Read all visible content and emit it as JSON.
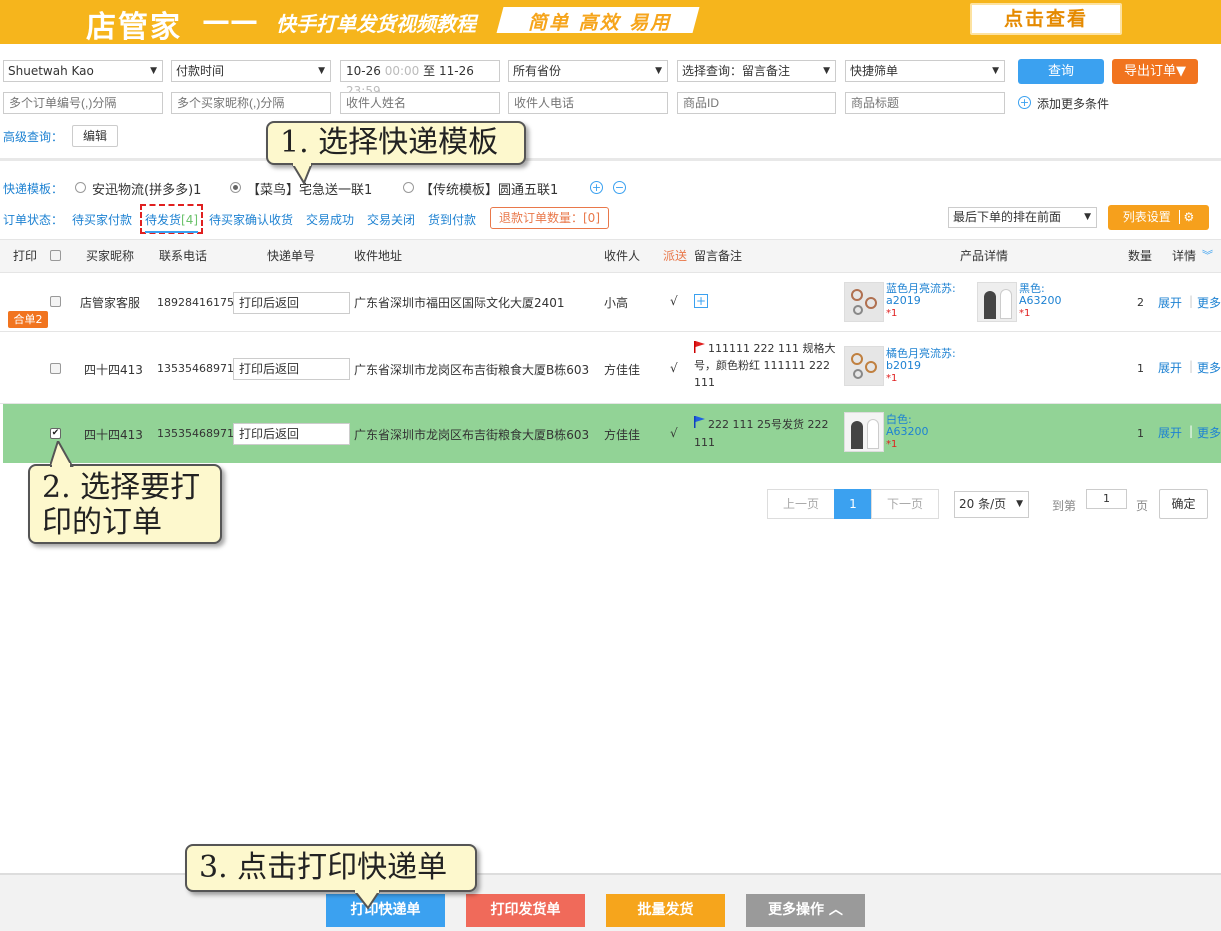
{
  "banner": {
    "logo": "店管家",
    "dash": "——",
    "title": "快手打单发货视频教程",
    "slogan": "简单 高效 易用",
    "view_button": "点击查看"
  },
  "filters": {
    "shop": "Shuetwah Kao",
    "time_type": "付款时间",
    "date_from_date": "10-26",
    "date_from_time": "00:00",
    "date_to_word": "至",
    "date_to_date": "11-26",
    "date_to_time": "23:59",
    "province": "所有省份",
    "query_select": "选择查询：留言备注",
    "quick_filter": "快捷筛单",
    "search_button": "查询",
    "export_button": "导出订单▼",
    "order_ids_placeholder": "多个订单编号(,)分隔",
    "buyer_nick_placeholder": "多个买家昵称(,)分隔",
    "receiver_name_placeholder": "收件人姓名",
    "receiver_phone_placeholder": "收件人电话",
    "product_id_placeholder": "商品ID",
    "product_title_placeholder": "商品标题",
    "add_more": "添加更多条件",
    "advanced_label": "高级查询：",
    "edit_button": "编辑"
  },
  "templates": {
    "label": "快递模板：",
    "options": [
      "安迅物流(拼多多)1",
      "【菜鸟】宅急送一联1",
      "【传统模板】圆通五联1"
    ]
  },
  "status": {
    "label": "订单状态：",
    "tabs": [
      "待买家付款",
      "待发货",
      "待买家确认收货",
      "交易成功",
      "交易关闭",
      "货到付款"
    ],
    "pending_count": "[4]",
    "refund_label": "退款订单数量：",
    "refund_count": "[0]",
    "sort": "最后下单的排在前面",
    "columns_button": "列表设置"
  },
  "table": {
    "headers": {
      "print": "打印",
      "buyer": "买家昵称",
      "phone": "联系电话",
      "tracking": "快递单号",
      "address": "收件地址",
      "receiver": "收件人",
      "dispatch": "派送",
      "remark": "留言备注",
      "product": "产品详情",
      "qty": "数量",
      "detail": "详情"
    },
    "rows": [
      {
        "badge": "合单2",
        "buyer": "店管家客服",
        "phone": "18928416175",
        "tracking": "打印后返回",
        "address": "广东省深圳市福田区国际文化大厦2401",
        "receiver": "小高",
        "dispatch": "√",
        "remark": "",
        "products": [
          {
            "name": "蓝色月亮流苏:",
            "code": "a2019",
            "qty": "*1"
          },
          {
            "name": "黑色:",
            "code": "A63200",
            "qty": "*1"
          }
        ],
        "qty": "2",
        "expand": "展开",
        "more": "更多"
      },
      {
        "buyer": "四十四413",
        "phone": "13535468971",
        "tracking": "打印后返回",
        "address": "广东省深圳市龙岗区布吉街粮食大厦B栋603",
        "receiver": "方佳佳",
        "dispatch": "√",
        "remark": "111111 222 111 规格大号，颜色粉红 111111 222 111",
        "products": [
          {
            "name": "橘色月亮流苏:",
            "code": "b2019",
            "qty": "*1"
          }
        ],
        "qty": "1",
        "expand": "展开",
        "more": "更多"
      },
      {
        "buyer": "四十四413",
        "phone": "13535468971",
        "tracking": "打印后返回",
        "address": "广东省深圳市龙岗区布吉街粮食大厦B栋603",
        "receiver": "方佳佳",
        "dispatch": "√",
        "remark": "222 111 25号发货 222 111",
        "products": [
          {
            "name": "白色:",
            "code": "A63200",
            "qty": "*1"
          }
        ],
        "qty": "1",
        "expand": "展开",
        "more": "更多",
        "selected": true
      }
    ]
  },
  "pagination": {
    "prev": "上一页",
    "current": "1",
    "next": "下一页",
    "per_page": "20 条/页",
    "goto_label": "到第",
    "goto_value": "1",
    "page_word": "页",
    "confirm": "确定"
  },
  "callouts": {
    "step1": "1. 选择快递模板",
    "step2_line1": "2. 选择要打",
    "step2_line2": "印的订单",
    "step3": "3. 点击打印快递单"
  },
  "bottom": {
    "print_express": "打印快递单",
    "print_invoice": "打印发货单",
    "batch_ship": "批量发货",
    "more_ops": "更多操作 ︿"
  },
  "colors": {
    "banner": "#f6b51c",
    "accent_blue": "#3ba1f0",
    "accent_orange": "#f1741f",
    "selected_row": "#92d396",
    "link": "#1e82d2"
  }
}
